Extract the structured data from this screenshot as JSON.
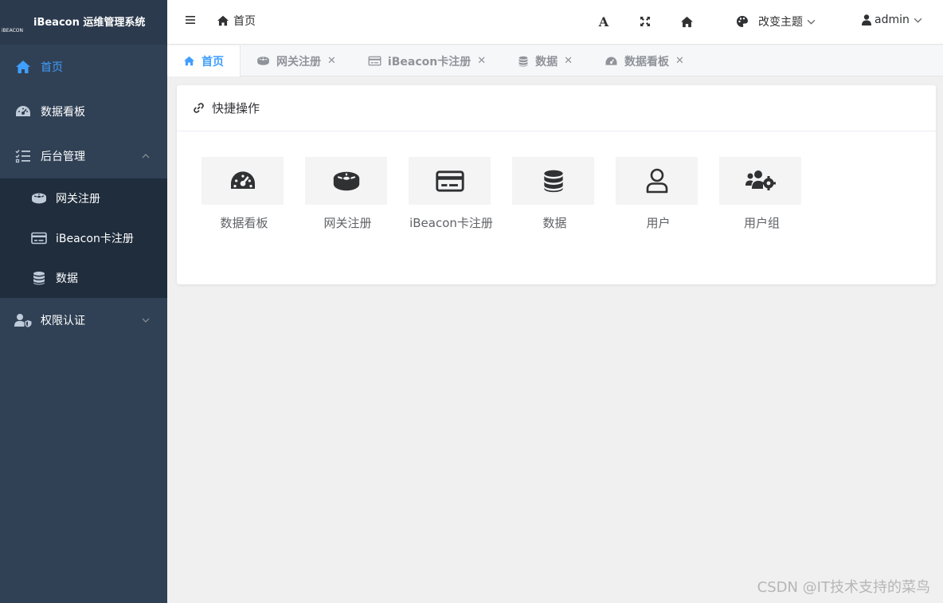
{
  "sidebar": {
    "logo_text": "iBEACON",
    "app_title": "iBeacon 运维管理系统",
    "items": [
      {
        "label": "首页",
        "icon": "home-icon",
        "active": true
      },
      {
        "label": "数据看板",
        "icon": "dashboard-icon"
      },
      {
        "label": "后台管理",
        "icon": "list-check-icon",
        "expanded": true
      },
      {
        "label": "权限认证",
        "icon": "user-shield-icon",
        "expanded": false
      }
    ],
    "sub_items": [
      {
        "label": "网关注册",
        "icon": "router-icon"
      },
      {
        "label": "iBeacon卡注册",
        "icon": "card-icon"
      },
      {
        "label": "数据",
        "icon": "database-icon"
      }
    ]
  },
  "header": {
    "breadcrumb": "首页",
    "theme_label": "改变主题",
    "user_label": "admin"
  },
  "tabs": [
    {
      "label": "首页",
      "icon": "home-icon",
      "active": true,
      "closable": false
    },
    {
      "label": "网关注册",
      "icon": "router-icon",
      "closable": true
    },
    {
      "label": "iBeacon卡注册",
      "icon": "card-icon",
      "closable": true
    },
    {
      "label": "数据",
      "icon": "database-icon",
      "closable": true
    },
    {
      "label": "数据看板",
      "icon": "dashboard-icon",
      "closable": true
    }
  ],
  "quick_actions": {
    "title": "快捷操作",
    "items": [
      {
        "label": "数据看板",
        "icon": "dashboard-icon"
      },
      {
        "label": "网关注册",
        "icon": "router-icon"
      },
      {
        "label": "iBeacon卡注册",
        "icon": "card-icon"
      },
      {
        "label": "数据",
        "icon": "database-icon"
      },
      {
        "label": "用户",
        "icon": "user-icon"
      },
      {
        "label": "用户组",
        "icon": "users-cog-icon"
      }
    ]
  },
  "watermark": "CSDN @IT技术支持的菜鸟",
  "colors": {
    "sidebar_bg": "#304156",
    "submenu_bg": "#1f2d3d",
    "accent": "#409eff",
    "page_bg": "#f0f0f0"
  }
}
